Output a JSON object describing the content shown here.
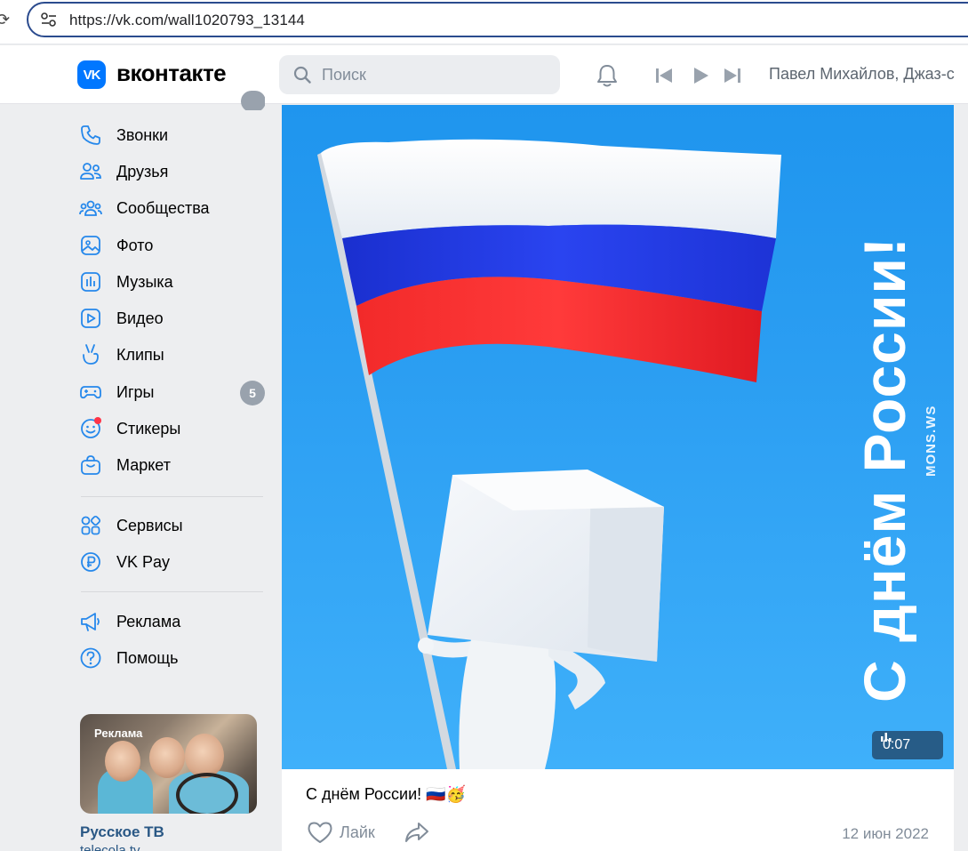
{
  "browser": {
    "url": "https://vk.com/wall1020793_13144"
  },
  "header": {
    "brand": "вконтакте",
    "logo_text": "VK",
    "search_placeholder": "Поиск",
    "now_playing": "Павел Михайлов, Джаз-с"
  },
  "sidebar": {
    "items": [
      {
        "label": "Звонки",
        "icon": "phone-icon"
      },
      {
        "label": "Друзья",
        "icon": "friends-icon"
      },
      {
        "label": "Сообщества",
        "icon": "communities-icon"
      },
      {
        "label": "Фото",
        "icon": "photo-icon"
      },
      {
        "label": "Музыка",
        "icon": "music-icon"
      },
      {
        "label": "Видео",
        "icon": "video-icon"
      },
      {
        "label": "Клипы",
        "icon": "clips-icon"
      },
      {
        "label": "Игры",
        "icon": "games-icon",
        "badge": "5"
      },
      {
        "label": "Стикеры",
        "icon": "stickers-icon"
      },
      {
        "label": "Маркет",
        "icon": "market-icon"
      },
      {
        "label": "Сервисы",
        "icon": "services-icon"
      },
      {
        "label": "VK Pay",
        "icon": "vkpay-icon"
      },
      {
        "label": "Реклама",
        "icon": "ads-icon"
      },
      {
        "label": "Помощь",
        "icon": "help-icon"
      }
    ],
    "ad": {
      "label": "Реклама",
      "title": "Русское ТВ",
      "subtitle": "telecola.tv"
    }
  },
  "post": {
    "video_text": "С днём России!",
    "watermark": "MONS.WS",
    "duration": "0:07",
    "caption": "С днём России! 🇷🇺🥳",
    "like_label": "Лайк",
    "date": "12 июн 2022"
  },
  "colors": {
    "vk_blue": "#0077ff",
    "link": "#2a5885",
    "secondary_text": "#818c99",
    "flag_white": "#ffffff",
    "flag_blue": "#1d33d6",
    "flag_red": "#e8202a"
  }
}
